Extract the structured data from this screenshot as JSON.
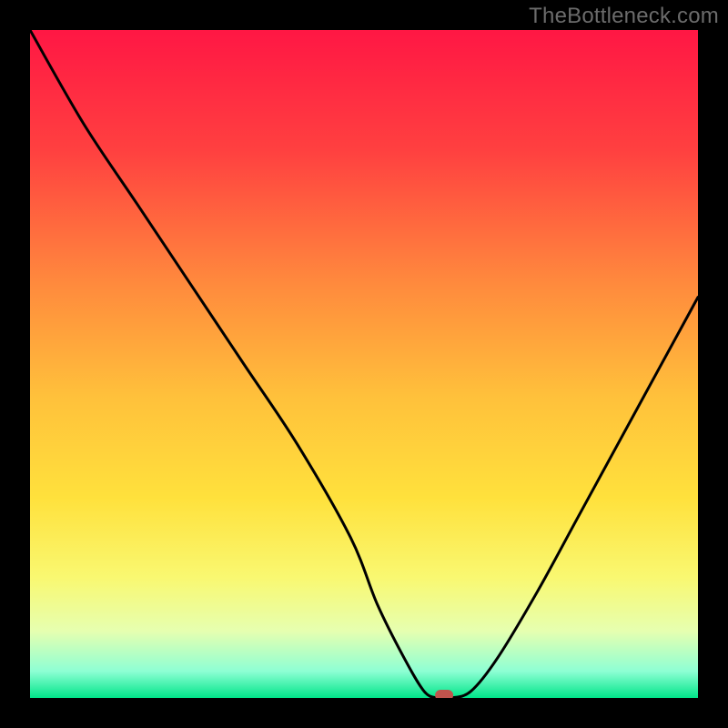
{
  "watermark": "TheBottleneck.com",
  "chart_data": {
    "type": "line",
    "title": "",
    "xlabel": "",
    "ylabel": "",
    "xlim": [
      0,
      100
    ],
    "ylim": [
      0,
      100
    ],
    "series": [
      {
        "name": "bottleneck-curve",
        "x": [
          0,
          8,
          16,
          24,
          32,
          40,
          48,
          52,
          56,
          59,
          61,
          63,
          66,
          70,
          76,
          82,
          88,
          94,
          100
        ],
        "values": [
          100,
          86,
          74,
          62,
          50,
          38,
          24,
          14,
          6,
          1,
          0,
          0,
          1,
          6,
          16,
          27,
          38,
          49,
          60
        ]
      }
    ],
    "marker": {
      "x": 62,
      "y": 0
    },
    "gradient_stops": [
      {
        "offset": 0,
        "color": "#ff1744"
      },
      {
        "offset": 18,
        "color": "#ff4040"
      },
      {
        "offset": 38,
        "color": "#ff8a3d"
      },
      {
        "offset": 55,
        "color": "#ffc13b"
      },
      {
        "offset": 70,
        "color": "#ffe13c"
      },
      {
        "offset": 82,
        "color": "#f9f871"
      },
      {
        "offset": 90,
        "color": "#e6ffb0"
      },
      {
        "offset": 96,
        "color": "#8effd4"
      },
      {
        "offset": 100,
        "color": "#00e589"
      }
    ]
  }
}
